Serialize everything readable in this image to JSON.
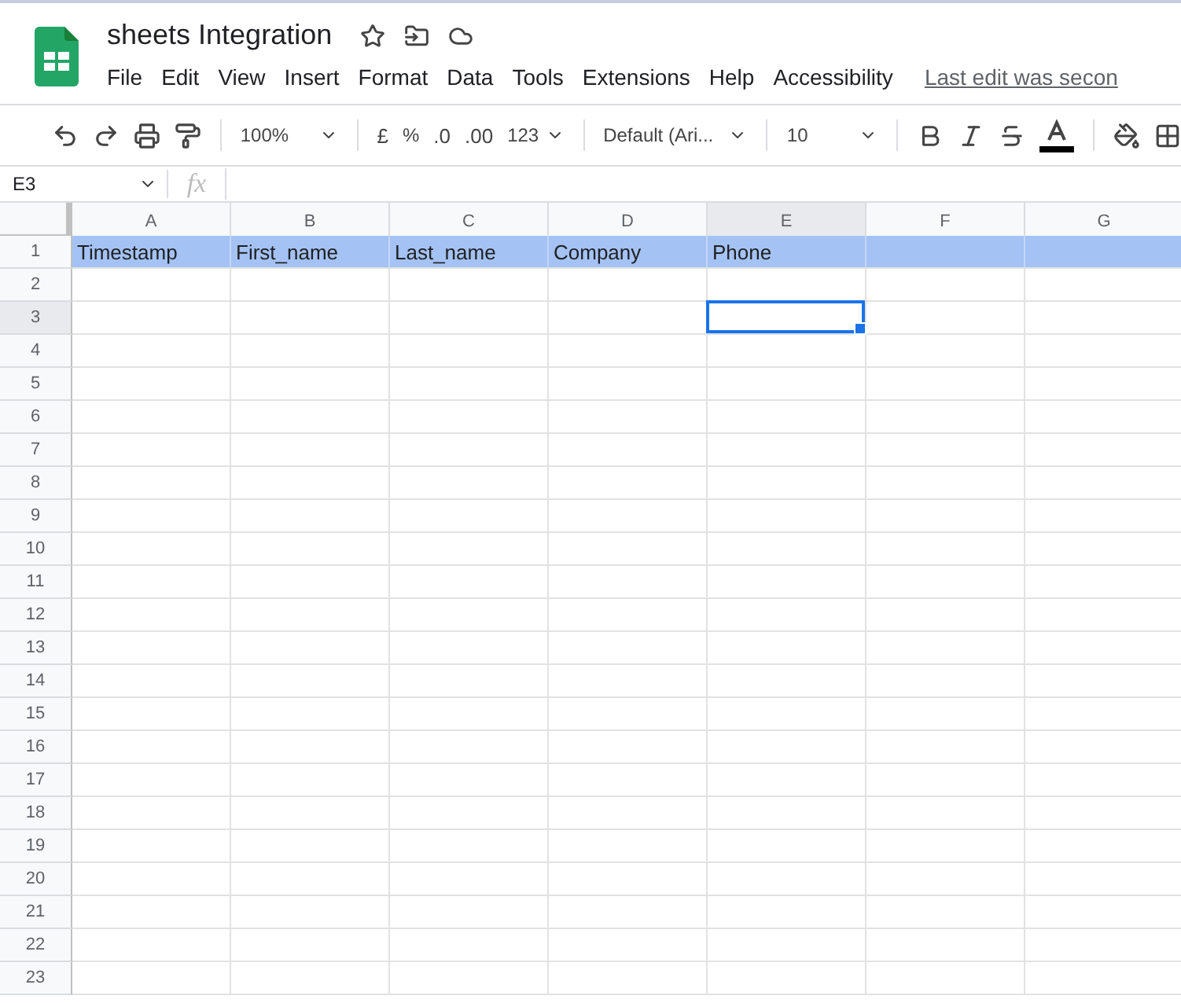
{
  "document": {
    "title": "sheets Integration",
    "last_edit": "Last edit was secon"
  },
  "menu": [
    "File",
    "Edit",
    "View",
    "Insert",
    "Format",
    "Data",
    "Tools",
    "Extensions",
    "Help",
    "Accessibility"
  ],
  "toolbar": {
    "zoom": "100%",
    "currency": "£",
    "percent": "%",
    "decrease_decimals": ".0",
    "increase_decimals": ".00",
    "number_format": "123",
    "font": "Default (Ari...",
    "font_size": "10"
  },
  "formula_bar": {
    "cell_reference": "E3",
    "fx": "fx"
  },
  "columns": [
    {
      "label": "A",
      "selected": false
    },
    {
      "label": "B",
      "selected": false
    },
    {
      "label": "C",
      "selected": false
    },
    {
      "label": "D",
      "selected": false
    },
    {
      "label": "E",
      "selected": true
    },
    {
      "label": "F",
      "selected": false
    },
    {
      "label": "G",
      "selected": false
    }
  ],
  "rows": [
    {
      "number": "1",
      "selected": false,
      "filled": true,
      "cells": [
        "Timestamp",
        "First_name",
        "Last_name",
        "Company",
        "Phone"
      ]
    },
    {
      "number": "2",
      "selected": false,
      "filled": false
    },
    {
      "number": "3",
      "selected": true,
      "filled": false
    },
    {
      "number": "4",
      "selected": false,
      "filled": false
    },
    {
      "number": "5",
      "selected": false,
      "filled": false
    },
    {
      "number": "6",
      "selected": false,
      "filled": false
    },
    {
      "number": "7",
      "selected": false,
      "filled": false
    },
    {
      "number": "8",
      "selected": false,
      "filled": false
    },
    {
      "number": "9",
      "selected": false,
      "filled": false
    },
    {
      "number": "10",
      "selected": false,
      "filled": false
    },
    {
      "number": "11",
      "selected": false,
      "filled": false
    },
    {
      "number": "12",
      "selected": false,
      "filled": false
    },
    {
      "number": "13",
      "selected": false,
      "filled": false
    },
    {
      "number": "14",
      "selected": false,
      "filled": false
    },
    {
      "number": "15",
      "selected": false,
      "filled": false
    },
    {
      "number": "16",
      "selected": false,
      "filled": false
    },
    {
      "number": "17",
      "selected": false,
      "filled": false
    },
    {
      "number": "18",
      "selected": false,
      "filled": false
    },
    {
      "number": "19",
      "selected": false,
      "filled": false
    },
    {
      "number": "20",
      "selected": false,
      "filled": false
    },
    {
      "number": "21",
      "selected": false,
      "filled": false
    },
    {
      "number": "22",
      "selected": false,
      "filled": false
    },
    {
      "number": "23",
      "selected": false,
      "filled": false
    }
  ]
}
